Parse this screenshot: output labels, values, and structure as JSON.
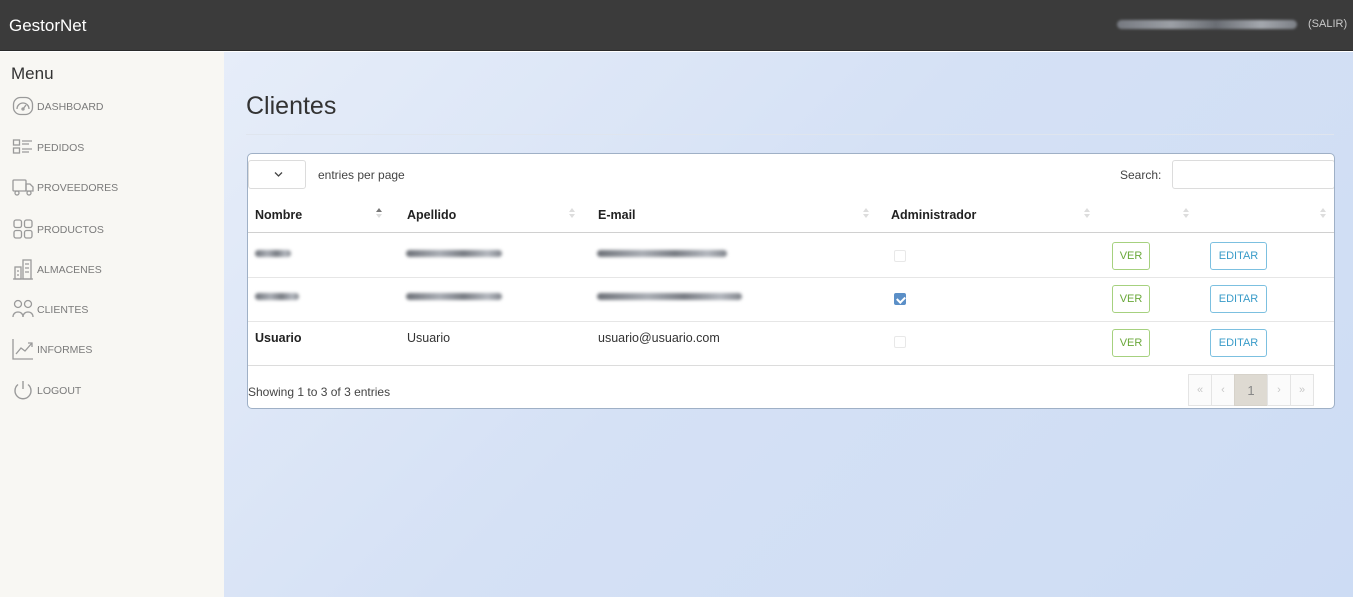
{
  "header": {
    "brand": "GestorNet",
    "logout": "(SALIR)"
  },
  "sidebar": {
    "title": "Menu",
    "items": [
      {
        "label": "DASHBOARD",
        "icon": "dashboard-gauge-icon"
      },
      {
        "label": "PEDIDOS",
        "icon": "list-icon"
      },
      {
        "label": "PROVEEDORES",
        "icon": "truck-icon"
      },
      {
        "label": "PRODUCTOS",
        "icon": "grid-icon"
      },
      {
        "label": "ALMACENES",
        "icon": "building-icon"
      },
      {
        "label": "CLIENTES",
        "icon": "users-icon"
      },
      {
        "label": "INFORMES",
        "icon": "chart-line-icon"
      },
      {
        "label": "LOGOUT",
        "icon": "power-icon"
      }
    ]
  },
  "page": {
    "title": "Clientes"
  },
  "table": {
    "length_label": "entries per page",
    "search_label": "Search:",
    "columns": [
      "Nombre",
      "Apellido",
      "E-mail",
      "Administrador",
      "",
      ""
    ],
    "rows": [
      {
        "nombre": "",
        "apellido": "",
        "email": "",
        "admin": false,
        "ver": "VER",
        "editar": "EDITAR"
      },
      {
        "nombre": "",
        "apellido": "",
        "email": "",
        "admin": true,
        "ver": "VER",
        "editar": "EDITAR"
      },
      {
        "nombre": "Usuario",
        "apellido": "Usuario",
        "email": "usuario@usuario.com",
        "admin": false,
        "ver": "VER",
        "editar": "EDITAR"
      }
    ],
    "info": "Showing 1 to 3 of 3 entries",
    "pagination": {
      "first": "«",
      "prev": "‹",
      "current": "1",
      "next": "›",
      "last": "»"
    }
  },
  "colors": {
    "topbar": "#3b3b3b",
    "sidebar": "#f8f7f3",
    "ver_green": "#6aa83a",
    "editar_blue": "#3a9cc9",
    "checkbox_checked": "#5b8fc7"
  }
}
